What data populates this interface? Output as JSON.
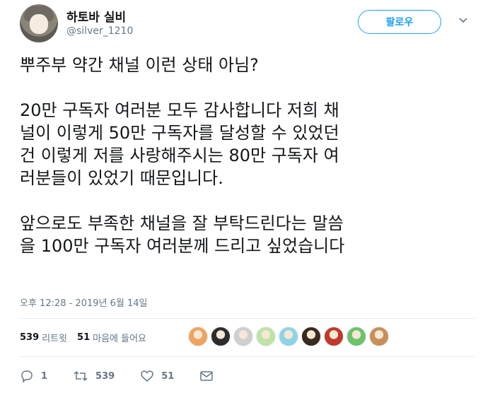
{
  "user": {
    "display_name": "하토바 실비",
    "handle": "@silver_1210"
  },
  "follow_button": {
    "label": "팔로우"
  },
  "tweet": {
    "text": "뿌주부 약간 채널 이런 상태 아님?\n\n20만 구독자 여러분 모두 감사합니다 저희 채\n널이 이렇게 50만 구독자를 달성할 수 있었던\n건 이렇게 저를 사랑해주시는 80만 구독자 여\n러분들이 있었기 때문입니다.\n\n앞으로도 부족한 채널을 잘 부탁드린다는 말씀\n을 100만 구독자 여러분께 드리고 싶었습니다",
    "timestamp": "오후 12:28 - 2019년 6월 14일"
  },
  "stats": {
    "retweets_count": "539",
    "retweets_label": "리트윗",
    "likes_count": "51",
    "likes_label": "마음에 들어요"
  },
  "likers": [
    {
      "name": "liker-avatar-1",
      "color": "#f0a35e"
    },
    {
      "name": "liker-avatar-2",
      "color": "#2d2d2d"
    },
    {
      "name": "liker-avatar-3",
      "color": "#cfcfcf"
    },
    {
      "name": "liker-avatar-4",
      "color": "#bfe3a6"
    },
    {
      "name": "liker-avatar-5",
      "color": "#8fd3e8"
    },
    {
      "name": "liker-avatar-6",
      "color": "#3a2a1c"
    },
    {
      "name": "liker-avatar-7",
      "color": "#c0392b"
    },
    {
      "name": "liker-avatar-8",
      "color": "#6dc26a"
    },
    {
      "name": "liker-avatar-9",
      "color": "#c98f5a"
    }
  ],
  "actions": {
    "reply_count": "1",
    "retweet_count": "539",
    "like_count": "51"
  },
  "colors": {
    "accent": "#1da1f2",
    "muted": "#657786",
    "divider": "#e6ecf0"
  }
}
